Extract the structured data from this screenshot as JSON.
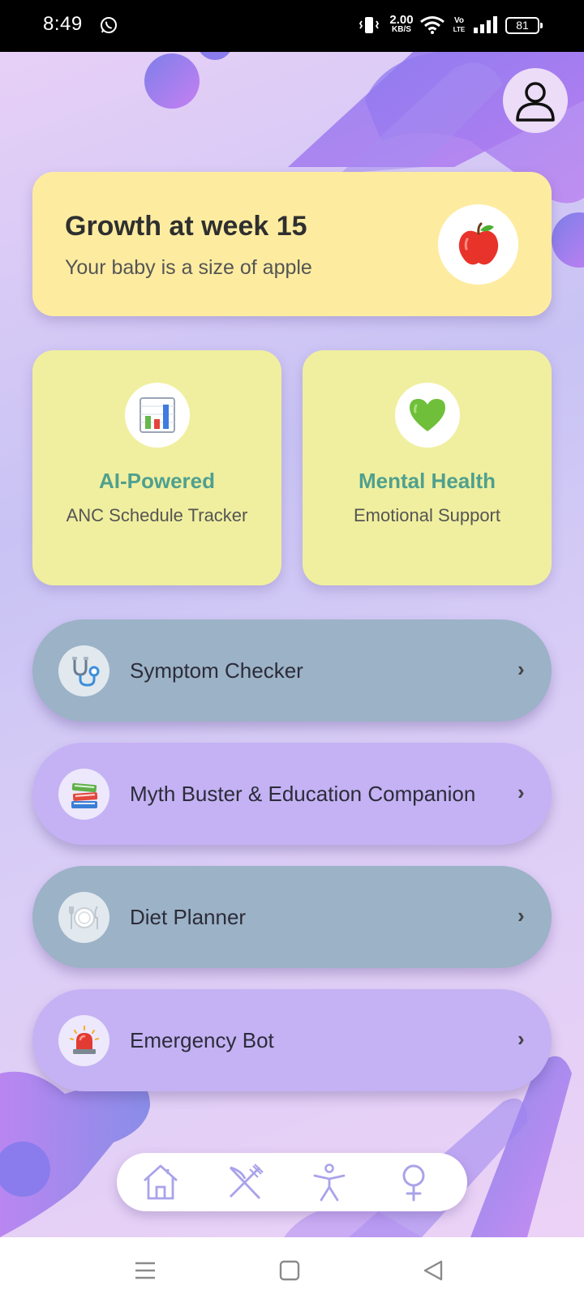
{
  "status_bar": {
    "time": "8:49",
    "network_speed": "2.00",
    "network_speed_unit": "KB/S",
    "volte_top": "Vo",
    "volte_bottom": "LTE",
    "battery": "81"
  },
  "growth": {
    "title": "Growth at week 15",
    "subtitle": "Your baby is a size of apple",
    "icon": "apple-icon"
  },
  "features": [
    {
      "title": "AI-Powered",
      "subtitle": "ANC Schedule Tracker",
      "icon": "bar-chart-icon"
    },
    {
      "title": "Mental Health",
      "subtitle": "Emotional Support",
      "icon": "green-heart-icon"
    }
  ],
  "menu": [
    {
      "label": "Symptom Checker",
      "icon": "stethoscope-icon",
      "chevron": "›"
    },
    {
      "label": "Myth Buster & Education Companion",
      "icon": "books-icon",
      "chevron": "›"
    },
    {
      "label": "Diet Planner",
      "icon": "plate-icon",
      "chevron": "›"
    },
    {
      "label": "Emergency Bot",
      "icon": "siren-icon",
      "chevron": "›"
    }
  ],
  "bottom_nav": [
    "home-icon",
    "fork-knife-icon",
    "accessibility-icon",
    "female-icon"
  ],
  "colors": {
    "growth_card": "#fdeca0",
    "feature_card": "#f0ef9f",
    "feature_title": "#4fa08f",
    "pill_blue": "#9cb2c7",
    "pill_purple": "#c4b2f4",
    "nav_icon": "#a9a3ea"
  }
}
